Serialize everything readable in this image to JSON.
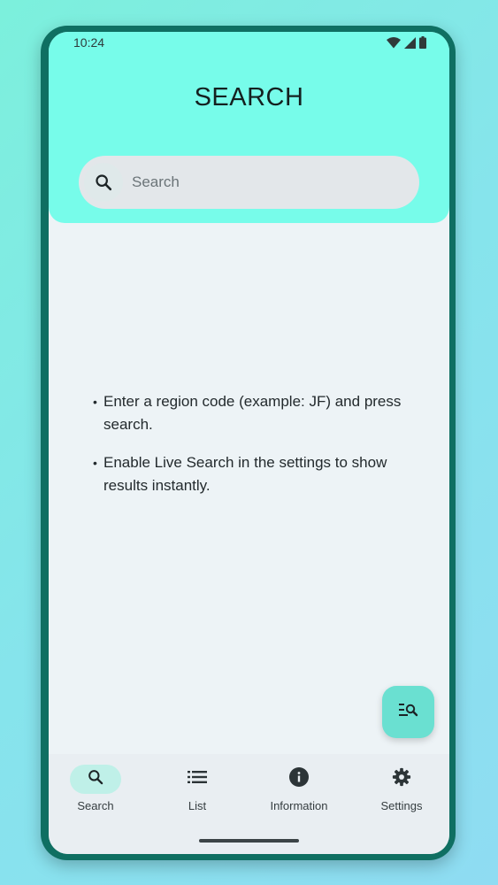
{
  "status_bar": {
    "time": "10:24",
    "icons": [
      "wifi-icon",
      "signal-icon",
      "battery-icon"
    ]
  },
  "header": {
    "title": "SEARCH"
  },
  "search": {
    "placeholder": "Search",
    "icon": "search-icon"
  },
  "info": {
    "items": [
      "Enter a region code (example: JF) and press search.",
      "Enable Live Search in the settings to show results instantly."
    ]
  },
  "fab": {
    "icon": "search-list-icon"
  },
  "nav": {
    "items": [
      {
        "label": "Search",
        "icon": "search-icon",
        "active": true
      },
      {
        "label": "List",
        "icon": "list-icon",
        "active": false
      },
      {
        "label": "Information",
        "icon": "info-icon",
        "active": false
      },
      {
        "label": "Settings",
        "icon": "gear-icon",
        "active": false
      }
    ]
  },
  "colors": {
    "header_bg": "#77fcea",
    "screen_bg": "#edf3f6",
    "fab_bg": "#6ae0d1",
    "nav_active_pill": "#bff0e8",
    "frame": "#0f6f62"
  }
}
